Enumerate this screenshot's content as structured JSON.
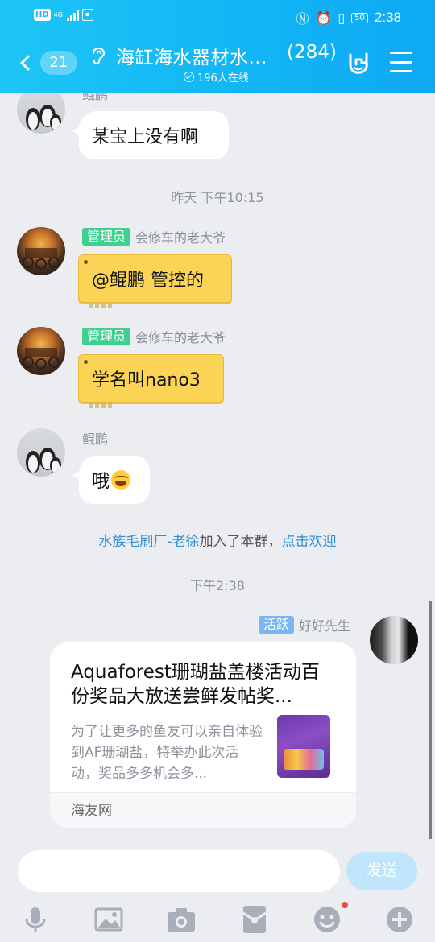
{
  "status_bar": {
    "hd": "HD",
    "network": "4G",
    "time": "2:38",
    "battery": "50"
  },
  "header": {
    "back_count": "21",
    "title": "海缸海水器材水...",
    "member_count": "(284)",
    "online": "196人在线"
  },
  "messages": [
    {
      "type": "text",
      "sender": "鲲鹏",
      "text": "某宝上没有啊"
    },
    {
      "type": "time",
      "text": "昨天 下午10:15"
    },
    {
      "type": "text",
      "badge": "管理员",
      "sender": "会修车的老大爷",
      "text": "@鲲鹏 管控的"
    },
    {
      "type": "text",
      "badge": "管理员",
      "sender": "会修车的老大爷",
      "text": "学名叫nano3"
    },
    {
      "type": "text",
      "sender": "鲲鹏",
      "text": "哦"
    },
    {
      "type": "system",
      "link": "水族毛刷厂-老徐",
      "text": "加入了本群，",
      "action": "点击欢迎"
    },
    {
      "type": "time",
      "text": "下午2:38"
    },
    {
      "type": "card",
      "badge": "活跃",
      "sender": "好好先生",
      "title": "Aquaforest珊瑚盐盖楼活动百份奖品大放送尝鲜发帖奖...",
      "desc": "为了让更多的鱼友可以亲自体验到AF珊瑚盐，特举办此次活动，奖品多多机会多...",
      "source": "海友网"
    }
  ],
  "input": {
    "value": "",
    "send_label": "发送"
  },
  "toolbar": [
    "mic-icon",
    "image-icon",
    "camera-icon",
    "red-packet-icon",
    "emoji-icon",
    "plus-icon"
  ],
  "colors": {
    "header": "#12b6f5",
    "admin_badge": "#3fcf8e",
    "active_badge": "#7cb6f2",
    "yellow_bubble": "#fcd455",
    "link": "#2f8fd8"
  }
}
